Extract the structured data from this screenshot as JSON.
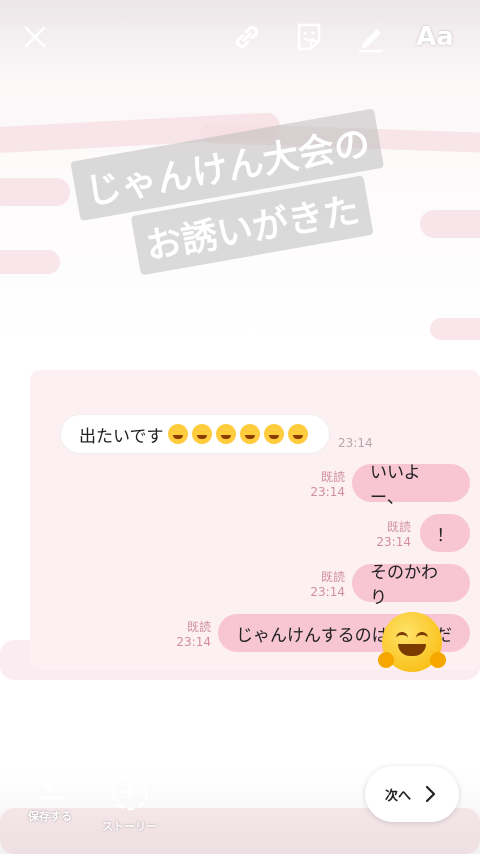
{
  "toolbar": {
    "close_label": "✕",
    "text_tool_label": "Aa"
  },
  "sticker": {
    "line1": "じゃんけん大会の",
    "line2": "お誘いがきた"
  },
  "chat": {
    "messages": [
      {
        "side": "left",
        "text": "出たいです",
        "time": "23:14",
        "emoji_count": 6
      },
      {
        "side": "right",
        "text": "いいよー、",
        "read": "既読",
        "time": "23:14"
      },
      {
        "side": "right",
        "text": "！",
        "read": "既読",
        "time": "23:14"
      },
      {
        "side": "right",
        "text": "そのかわり",
        "read": "既読",
        "time": "23:14"
      },
      {
        "side": "right",
        "text": "じゃんけんするのは",
        "suffix": "だ",
        "read": "既読",
        "time": "23:14"
      }
    ]
  },
  "bottom": {
    "save_label": "保存する",
    "story_label": "ストーリー",
    "next_label": "次へ"
  },
  "colors": {
    "accent_pink": "#f7c5d3",
    "read_text": "#d18ea0"
  }
}
